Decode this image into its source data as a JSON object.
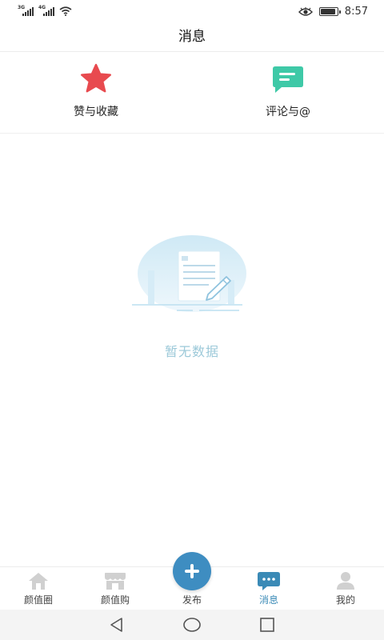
{
  "status_bar": {
    "signal1_tag": "3G",
    "signal2_tag": "4G",
    "time": "8:57",
    "battery_level": 0.9
  },
  "header": {
    "title": "消息"
  },
  "entries": [
    {
      "label": "赞与收藏",
      "icon": "star-icon",
      "color": "#e84a4f"
    },
    {
      "label": "评论与@",
      "icon": "comment-icon",
      "color": "#3ec9a7"
    }
  ],
  "empty_state": {
    "text": "暂无数据"
  },
  "tabbar": {
    "tabs": [
      {
        "label": "颜值圈",
        "icon": "home-icon",
        "active": false
      },
      {
        "label": "颜值购",
        "icon": "store-icon",
        "active": false
      },
      {
        "label": "发布",
        "icon": "plus-icon",
        "active": false
      },
      {
        "label": "消息",
        "icon": "message-icon",
        "active": true
      },
      {
        "label": "我的",
        "icon": "user-icon",
        "active": false
      }
    ]
  },
  "colors": {
    "accent": "#3e8dc1",
    "active_tab": "#3a8ab6",
    "inactive_icon": "#d0d0d0",
    "empty_text": "#9cc9d9"
  }
}
